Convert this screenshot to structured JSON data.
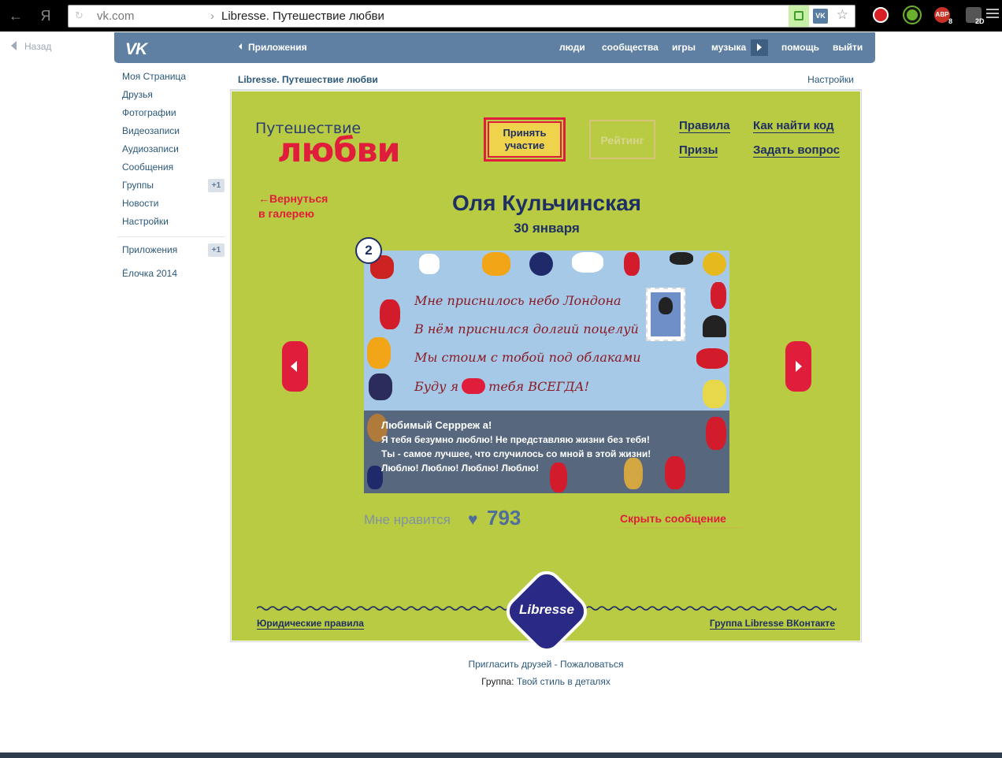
{
  "browser": {
    "domain": "vk.com",
    "separator": "›",
    "page_title": "Libresse. Путешествие любви",
    "ext_abp_label": "ABP",
    "ext_abp_count": "8",
    "ext_last_count": "2D",
    "nav_back_glyph": "←",
    "nav_yandex_glyph": "Я"
  },
  "back_link": "Назад",
  "vk_header": {
    "logo": "VK",
    "apps": "Приложения",
    "nav": [
      "люди",
      "сообщества",
      "игры",
      "музыка",
      "помощь",
      "выйти"
    ]
  },
  "left_menu": {
    "items": [
      "Моя Страница",
      "Друзья",
      "Фотографии",
      "Видеозаписи",
      "Аудиозаписи",
      "Сообщения",
      "Группы",
      "Новости",
      "Настройки"
    ],
    "groups_badge": "+1",
    "apps": "Приложения",
    "apps_badge": "+1",
    "extra": "Ёлочка 2014"
  },
  "app_header": {
    "title": "Libresse. Путешествие любви",
    "settings": "Настройки"
  },
  "game": {
    "logo_top": "Путешествие",
    "logo_bottom": "любви",
    "btn_take_part": "Принять участие",
    "btn_rating": "Рейтинг",
    "links": [
      "Правила",
      "Как найти код",
      "Призы",
      "Задать вопрос"
    ],
    "back_to_gallery": "←Вернуться в галерею",
    "participant_name": "Оля Кульчинская",
    "date": "30 января",
    "card_number": "2",
    "poem_lines": [
      "Мне приснилось небо Лондона",
      "В нём приснился долгий поцелуй",
      "Мы стоим с тобой под облаками"
    ],
    "poem_last_start": "Буду я",
    "poem_last_end": "тебя ВСЕГДА!",
    "message_lines": [
      "Любимый Серрреж а!",
      "Я тебя безумно люблю! Не представляю жизни без тебя!",
      "Ты - самое лучшее, что случилось со мной в этой жизни!",
      "Люблю! Люблю! Люблю! Люблю!"
    ],
    "like_label": "Мне нравится",
    "like_count": "793",
    "hide_message": "Скрыть сообщение",
    "brand": "Libresse",
    "footer_left": "Юридические правила",
    "footer_right": "Группа Libresse ВКонтакте"
  },
  "page_footer": {
    "invite": "Пригласить друзей",
    "dash": " - ",
    "complain": "Пожаловаться",
    "group_label": "Группа:",
    "group_name": "Твой стиль в деталях"
  },
  "colors": {
    "vk_blue": "#5f80a2",
    "app_green": "#b9ca43",
    "accent_red": "#e11d3c",
    "navy": "#1e2f63"
  }
}
